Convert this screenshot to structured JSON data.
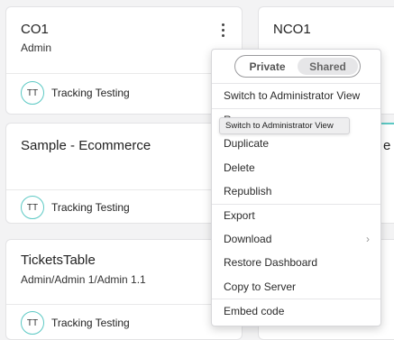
{
  "cards": [
    {
      "title": "CO1",
      "subtitle": "Admin",
      "avatar": "TT",
      "owner": "Tracking Testing"
    },
    {
      "title": "NCO1"
    },
    {
      "title": "Sample - Ecommerce",
      "avatar": "TT",
      "owner": "Tracking Testing"
    },
    {
      "title_fragment": "e"
    },
    {
      "title": "TicketsTable",
      "subtitle": "Admin/Admin 1/Admin 1.1",
      "avatar": "TT",
      "owner": "Tracking Testing"
    }
  ],
  "menu": {
    "toggle": {
      "private_label": "Private",
      "shared_label": "Shared",
      "selected": "Shared"
    },
    "items": [
      "Switch to Administrator View",
      "Duplicate",
      "Delete",
      "Republish",
      "Export",
      "Download",
      "Restore Dashboard",
      "Copy to Server",
      "Embed code"
    ],
    "hidden_item_fragment": "R"
  },
  "tooltip": {
    "text": "Switch to Administrator View"
  },
  "colors": {
    "accent": "#5cc9c4",
    "background": "#f3f3f4",
    "card": "#ffffff"
  },
  "icons": {
    "more": "kebab-vertical-icon",
    "submenu": "chevron-right-icon"
  }
}
